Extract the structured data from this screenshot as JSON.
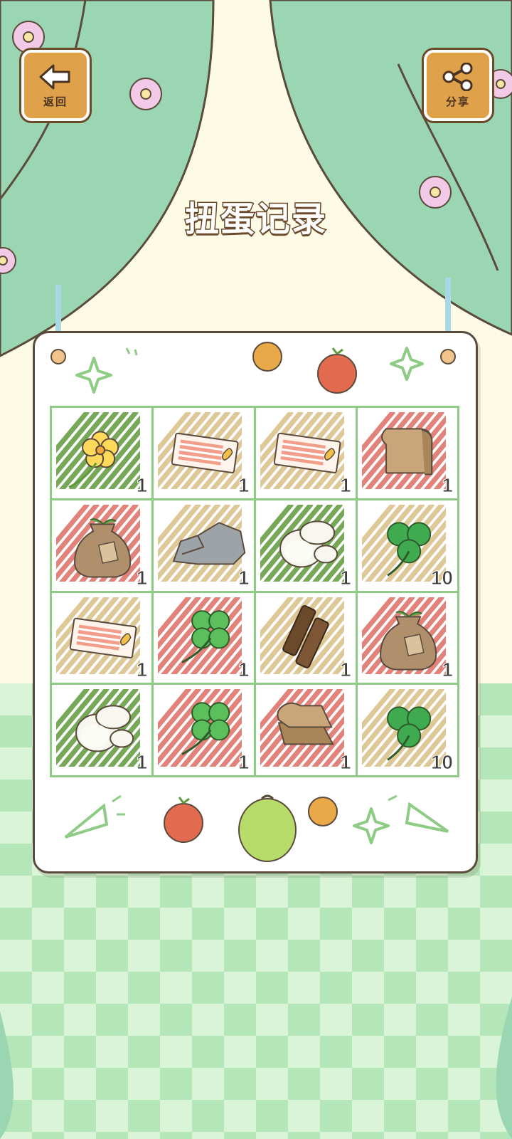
{
  "header": {
    "title": "扭蛋记录"
  },
  "back_button": {
    "label": "返回",
    "icon": "back-arrow-icon"
  },
  "share_button": {
    "label": "分享",
    "icon": "share-icon"
  },
  "colors": {
    "hatch_green": "#5f9a3c",
    "hatch_red": "#dd6e64",
    "hatch_tan": "#d9bf86",
    "grid_border": "#8ecb85",
    "curtain": "#9bd6b3"
  },
  "grid": [
    {
      "item": "yellow-flower",
      "hatch": "green",
      "count": "1"
    },
    {
      "item": "ticket",
      "hatch": "tan",
      "count": "1"
    },
    {
      "item": "ticket",
      "hatch": "tan",
      "count": "1"
    },
    {
      "item": "bread",
      "hatch": "red",
      "count": "1"
    },
    {
      "item": "seed-bag",
      "hatch": "red",
      "count": "1"
    },
    {
      "item": "rock",
      "hatch": "tan",
      "count": "1"
    },
    {
      "item": "mochi",
      "hatch": "green",
      "count": "1"
    },
    {
      "item": "three-leaf-clover",
      "hatch": "tan",
      "count": "10"
    },
    {
      "item": "ticket",
      "hatch": "tan",
      "count": "1"
    },
    {
      "item": "four-leaf-clover",
      "hatch": "red",
      "count": "1"
    },
    {
      "item": "bark",
      "hatch": "tan",
      "count": "1"
    },
    {
      "item": "seed-bag",
      "hatch": "red",
      "count": "1"
    },
    {
      "item": "mochi",
      "hatch": "green",
      "count": "1"
    },
    {
      "item": "four-leaf-clover",
      "hatch": "red",
      "count": "1"
    },
    {
      "item": "bread-slices",
      "hatch": "red",
      "count": "1"
    },
    {
      "item": "three-leaf-clover",
      "hatch": "tan",
      "count": "10"
    }
  ]
}
